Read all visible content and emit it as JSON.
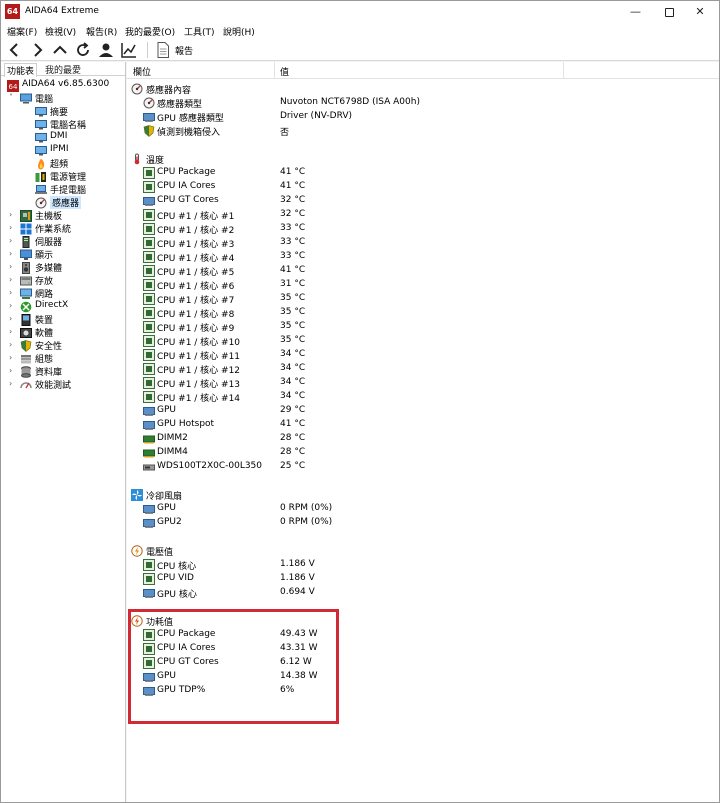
{
  "window": {
    "app_icon_text": "64",
    "title": "AIDA64 Extreme",
    "minimize": "—",
    "close": "✕"
  },
  "menu": [
    "檔案(F)",
    "檢視(V)",
    "報告(R)",
    "我的最愛(O)",
    "工具(T)",
    "說明(H)"
  ],
  "toolbar": {
    "report_label": "報告"
  },
  "left_panel": {
    "tabs": [
      "功能表",
      "我的最愛"
    ],
    "tree": [
      {
        "label": "AIDA64 v6.85.6300",
        "icon": "aida-icon",
        "level": 0
      },
      {
        "label": "電腦",
        "icon": "computer-icon",
        "level": 1,
        "expander": "˅"
      },
      {
        "label": "摘要",
        "icon": "monitor-icon",
        "level": 2
      },
      {
        "label": "電腦名稱",
        "icon": "monitor-icon",
        "level": 2
      },
      {
        "label": "DMI",
        "icon": "monitor-icon",
        "level": 2
      },
      {
        "label": "IPMI",
        "icon": "monitor-icon",
        "level": 2
      },
      {
        "label": "超頻",
        "icon": "fire-icon",
        "level": 2
      },
      {
        "label": "電源管理",
        "icon": "plug-icon",
        "level": 2
      },
      {
        "label": "手提電腦",
        "icon": "laptop-icon",
        "level": 2
      },
      {
        "label": "感應器",
        "icon": "sensor-icon",
        "level": 2,
        "selected": true
      },
      {
        "label": "主機板",
        "icon": "motherboard-icon",
        "level": 1,
        "expander": "›"
      },
      {
        "label": "作業系統",
        "icon": "windows-icon",
        "level": 1,
        "expander": "›"
      },
      {
        "label": "伺服器",
        "icon": "server-icon",
        "level": 1,
        "expander": "›"
      },
      {
        "label": "顯示",
        "icon": "display-icon",
        "level": 1,
        "expander": "›"
      },
      {
        "label": "多媒體",
        "icon": "speaker-icon",
        "level": 1,
        "expander": "›"
      },
      {
        "label": "存放",
        "icon": "storage-icon",
        "level": 1,
        "expander": "›"
      },
      {
        "label": "網路",
        "icon": "network-icon",
        "level": 1,
        "expander": "›"
      },
      {
        "label": "DirectX",
        "icon": "xbox-icon",
        "level": 1,
        "expander": "›"
      },
      {
        "label": "裝置",
        "icon": "device-icon",
        "level": 1,
        "expander": "›"
      },
      {
        "label": "軟體",
        "icon": "software-icon",
        "level": 1,
        "expander": "›"
      },
      {
        "label": "安全性",
        "icon": "shield-icon",
        "level": 1,
        "expander": "›"
      },
      {
        "label": "組態",
        "icon": "config-icon",
        "level": 1,
        "expander": "›"
      },
      {
        "label": "資料庫",
        "icon": "database-icon",
        "level": 1,
        "expander": "›"
      },
      {
        "label": "效能測試",
        "icon": "benchmark-icon",
        "level": 1,
        "expander": "›"
      }
    ]
  },
  "columns": {
    "field": "欄位",
    "value": "值"
  },
  "rows": [
    {
      "type": "group",
      "name": "感應器內容",
      "icon": "sensor-icon"
    },
    {
      "type": "item",
      "name": "感應器類型",
      "value": "Nuvoton NCT6798D  (ISA A00h)",
      "icon": "sensor-icon"
    },
    {
      "type": "item",
      "name": "GPU 感應器類型",
      "value": "Driver  (NV-DRV)",
      "icon": "gpu-icon"
    },
    {
      "type": "item",
      "name": "偵測到機箱侵入",
      "value": "否",
      "icon": "shield-icon"
    },
    {
      "type": "spacer"
    },
    {
      "type": "group",
      "name": "溫度",
      "icon": "thermometer-icon"
    },
    {
      "type": "item",
      "name": "CPU Package",
      "value": "41 °C",
      "icon": "chip-icon"
    },
    {
      "type": "item",
      "name": "CPU IA Cores",
      "value": "41 °C",
      "icon": "chip-icon"
    },
    {
      "type": "item",
      "name": "CPU GT Cores",
      "value": "32 °C",
      "icon": "gpu-icon"
    },
    {
      "type": "item",
      "name": "CPU #1 / 核心 #1",
      "value": "32 °C",
      "icon": "chip-icon"
    },
    {
      "type": "item",
      "name": "CPU #1 / 核心 #2",
      "value": "33 °C",
      "icon": "chip-icon"
    },
    {
      "type": "item",
      "name": "CPU #1 / 核心 #3",
      "value": "33 °C",
      "icon": "chip-icon"
    },
    {
      "type": "item",
      "name": "CPU #1 / 核心 #4",
      "value": "33 °C",
      "icon": "chip-icon"
    },
    {
      "type": "item",
      "name": "CPU #1 / 核心 #5",
      "value": "41 °C",
      "icon": "chip-icon"
    },
    {
      "type": "item",
      "name": "CPU #1 / 核心 #6",
      "value": "31 °C",
      "icon": "chip-icon"
    },
    {
      "type": "item",
      "name": "CPU #1 / 核心 #7",
      "value": "35 °C",
      "icon": "chip-icon"
    },
    {
      "type": "item",
      "name": "CPU #1 / 核心 #8",
      "value": "35 °C",
      "icon": "chip-icon"
    },
    {
      "type": "item",
      "name": "CPU #1 / 核心 #9",
      "value": "35 °C",
      "icon": "chip-icon"
    },
    {
      "type": "item",
      "name": "CPU #1 / 核心 #10",
      "value": "35 °C",
      "icon": "chip-icon"
    },
    {
      "type": "item",
      "name": "CPU #1 / 核心 #11",
      "value": "34 °C",
      "icon": "chip-icon"
    },
    {
      "type": "item",
      "name": "CPU #1 / 核心 #12",
      "value": "34 °C",
      "icon": "chip-icon"
    },
    {
      "type": "item",
      "name": "CPU #1 / 核心 #13",
      "value": "34 °C",
      "icon": "chip-icon"
    },
    {
      "type": "item",
      "name": "CPU #1 / 核心 #14",
      "value": "34 °C",
      "icon": "chip-icon"
    },
    {
      "type": "item",
      "name": "GPU",
      "value": "29 °C",
      "icon": "gpu-icon"
    },
    {
      "type": "item",
      "name": "GPU Hotspot",
      "value": "41 °C",
      "icon": "gpu-icon"
    },
    {
      "type": "item",
      "name": "DIMM2",
      "value": "28 °C",
      "icon": "dimm-icon"
    },
    {
      "type": "item",
      "name": "DIMM4",
      "value": "28 °C",
      "icon": "dimm-icon"
    },
    {
      "type": "item",
      "name": "WDS100T2X0C-00L350",
      "value": "25 °C",
      "icon": "disk-icon"
    },
    {
      "type": "spacer"
    },
    {
      "type": "group",
      "name": "冷卻風扇",
      "icon": "fan-icon"
    },
    {
      "type": "item",
      "name": "GPU",
      "value": "0 RPM  (0%)",
      "icon": "gpu-icon"
    },
    {
      "type": "item",
      "name": "GPU2",
      "value": "0 RPM  (0%)",
      "icon": "gpu-icon"
    },
    {
      "type": "spacer"
    },
    {
      "type": "group",
      "name": "電壓值",
      "icon": "voltage-icon"
    },
    {
      "type": "item",
      "name": "CPU 核心",
      "value": "1.186 V",
      "icon": "chip-icon"
    },
    {
      "type": "item",
      "name": "CPU VID",
      "value": "1.186 V",
      "icon": "chip-icon"
    },
    {
      "type": "item",
      "name": "GPU 核心",
      "value": "0.694 V",
      "icon": "gpu-icon"
    },
    {
      "type": "spacer"
    },
    {
      "type": "group",
      "name": "功耗值",
      "icon": "power-icon"
    },
    {
      "type": "item",
      "name": "CPU Package",
      "value": "49.43 W",
      "icon": "chip-icon"
    },
    {
      "type": "item",
      "name": "CPU IA Cores",
      "value": "43.31 W",
      "icon": "chip-icon"
    },
    {
      "type": "item",
      "name": "CPU GT Cores",
      "value": "6.12 W",
      "icon": "chip-icon"
    },
    {
      "type": "item",
      "name": "GPU",
      "value": "14.38 W",
      "icon": "gpu-icon"
    },
    {
      "type": "item",
      "name": "GPU TDP%",
      "value": "6%",
      "icon": "gpu-icon"
    }
  ],
  "colors": {
    "highlight": "#d22a35",
    "selection": "#cde8ff"
  }
}
